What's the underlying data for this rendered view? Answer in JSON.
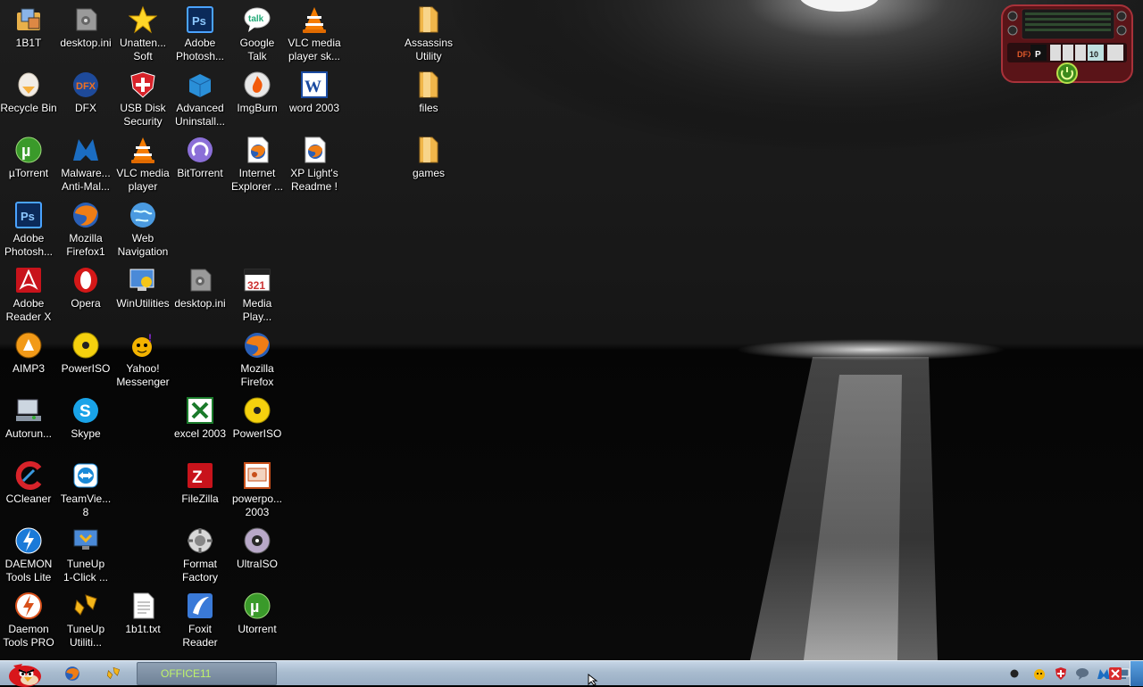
{
  "desktop": {
    "icons": [
      {
        "label": "1B1T",
        "icon": "folder-app-icon"
      },
      {
        "label": "desktop.ini",
        "icon": "settings-file-icon"
      },
      {
        "label": "Unatten...\nSoft",
        "icon": "star-icon"
      },
      {
        "label": "Adobe\nPhotosh...",
        "icon": "photoshop-icon"
      },
      {
        "label": "Google\nTalk",
        "icon": "google-talk-icon"
      },
      {
        "label": "VLC media\nplayer sk...",
        "icon": "vlc-icon"
      },
      {
        "label": "Assassins\nUtility",
        "icon": "folder-icon"
      },
      {
        "label": "Recycle Bin",
        "icon": "recycle-bin-icon"
      },
      {
        "label": "DFX",
        "icon": "dfx-icon"
      },
      {
        "label": "USB Disk\nSecurity",
        "icon": "shield-icon"
      },
      {
        "label": "Advanced\nUninstall...",
        "icon": "uninstaller-box-icon"
      },
      {
        "label": "ImgBurn",
        "icon": "imgburn-icon"
      },
      {
        "label": "word 2003",
        "icon": "word-icon"
      },
      {
        "label": "files",
        "icon": "folder-icon"
      },
      {
        "label": "µTorrent",
        "icon": "utorrent-icon"
      },
      {
        "label": "Malware...\nAnti-Mal...",
        "icon": "malwarebytes-icon"
      },
      {
        "label": "VLC media\nplayer",
        "icon": "vlc-icon"
      },
      {
        "label": "BitTorrent",
        "icon": "bittorrent-icon"
      },
      {
        "label": "Internet\nExplorer ...",
        "icon": "firefox-doc-icon"
      },
      {
        "label": "XP Light's\nReadme !",
        "icon": "firefox-doc-icon"
      },
      {
        "label": "games",
        "icon": "folder-icon"
      },
      {
        "label": "Adobe\nPhotosh...",
        "icon": "photoshop-icon"
      },
      {
        "label": "Mozilla\nFirefox1",
        "icon": "firefox-icon"
      },
      {
        "label": "Web\nNavigation",
        "icon": "globe-icon"
      },
      {
        "label": "Adobe\nReader X",
        "icon": "adobe-reader-icon"
      },
      {
        "label": "Opera",
        "icon": "opera-icon"
      },
      {
        "label": "WinUtilities",
        "icon": "winutilities-icon"
      },
      {
        "label": "desktop.ini",
        "icon": "settings-file-icon"
      },
      {
        "label": "Media\nPlay...",
        "icon": "media-player-icon"
      },
      {
        "label": "AIMP3",
        "icon": "aimp-icon"
      },
      {
        "label": "PowerISO",
        "icon": "poweriso-icon"
      },
      {
        "label": "Yahoo!\nMessenger",
        "icon": "yahoo-messenger-icon"
      },
      {
        "label": "Mozilla\nFirefox",
        "icon": "firefox-icon"
      },
      {
        "label": "Autorun...",
        "icon": "autorun-icon"
      },
      {
        "label": "Skype",
        "icon": "skype-icon"
      },
      {
        "label": "excel 2003",
        "icon": "excel-icon"
      },
      {
        "label": "PowerISO",
        "icon": "poweriso-icon"
      },
      {
        "label": "CCleaner",
        "icon": "ccleaner-icon"
      },
      {
        "label": "TeamVie...\n8",
        "icon": "teamviewer-icon"
      },
      {
        "label": "FileZilla",
        "icon": "filezilla-icon"
      },
      {
        "label": "powerpo...\n2003",
        "icon": "powerpoint-icon"
      },
      {
        "label": "DAEMON\nTools Lite",
        "icon": "daemon-tools-icon"
      },
      {
        "label": "TuneUp\n1-Click ...",
        "icon": "tuneup-monitor-icon"
      },
      {
        "label": "Format\nFactory",
        "icon": "format-factory-icon"
      },
      {
        "label": "UltraISO",
        "icon": "ultraiso-icon"
      },
      {
        "label": "Daemon\nTools PRO",
        "icon": "daemon-pro-icon"
      },
      {
        "label": "TuneUp\nUtiliti...",
        "icon": "tuneup-icon"
      },
      {
        "label": "1b1t.txt",
        "icon": "text-file-icon"
      },
      {
        "label": "Foxit\nReader",
        "icon": "foxit-icon"
      },
      {
        "label": "Utorrent",
        "icon": "utorrent-icon"
      }
    ]
  },
  "widget": {
    "logo": "DFX",
    "preset": "P",
    "count": "10"
  },
  "taskbar": {
    "start_icon": "angry-bird-icon",
    "pinned": [
      {
        "icon": "firefox-icon"
      },
      {
        "icon": "tuneup-icon"
      }
    ],
    "active_window": {
      "label": "OFFICE11"
    },
    "tray": [
      "record-dot-icon",
      "yahoo-tray-icon",
      "shield-tray-icon",
      "chat-bubble-icon",
      "malwarebytes-tray-icon",
      "network-icon",
      "checkmark-icon",
      "close-red-icon"
    ]
  }
}
